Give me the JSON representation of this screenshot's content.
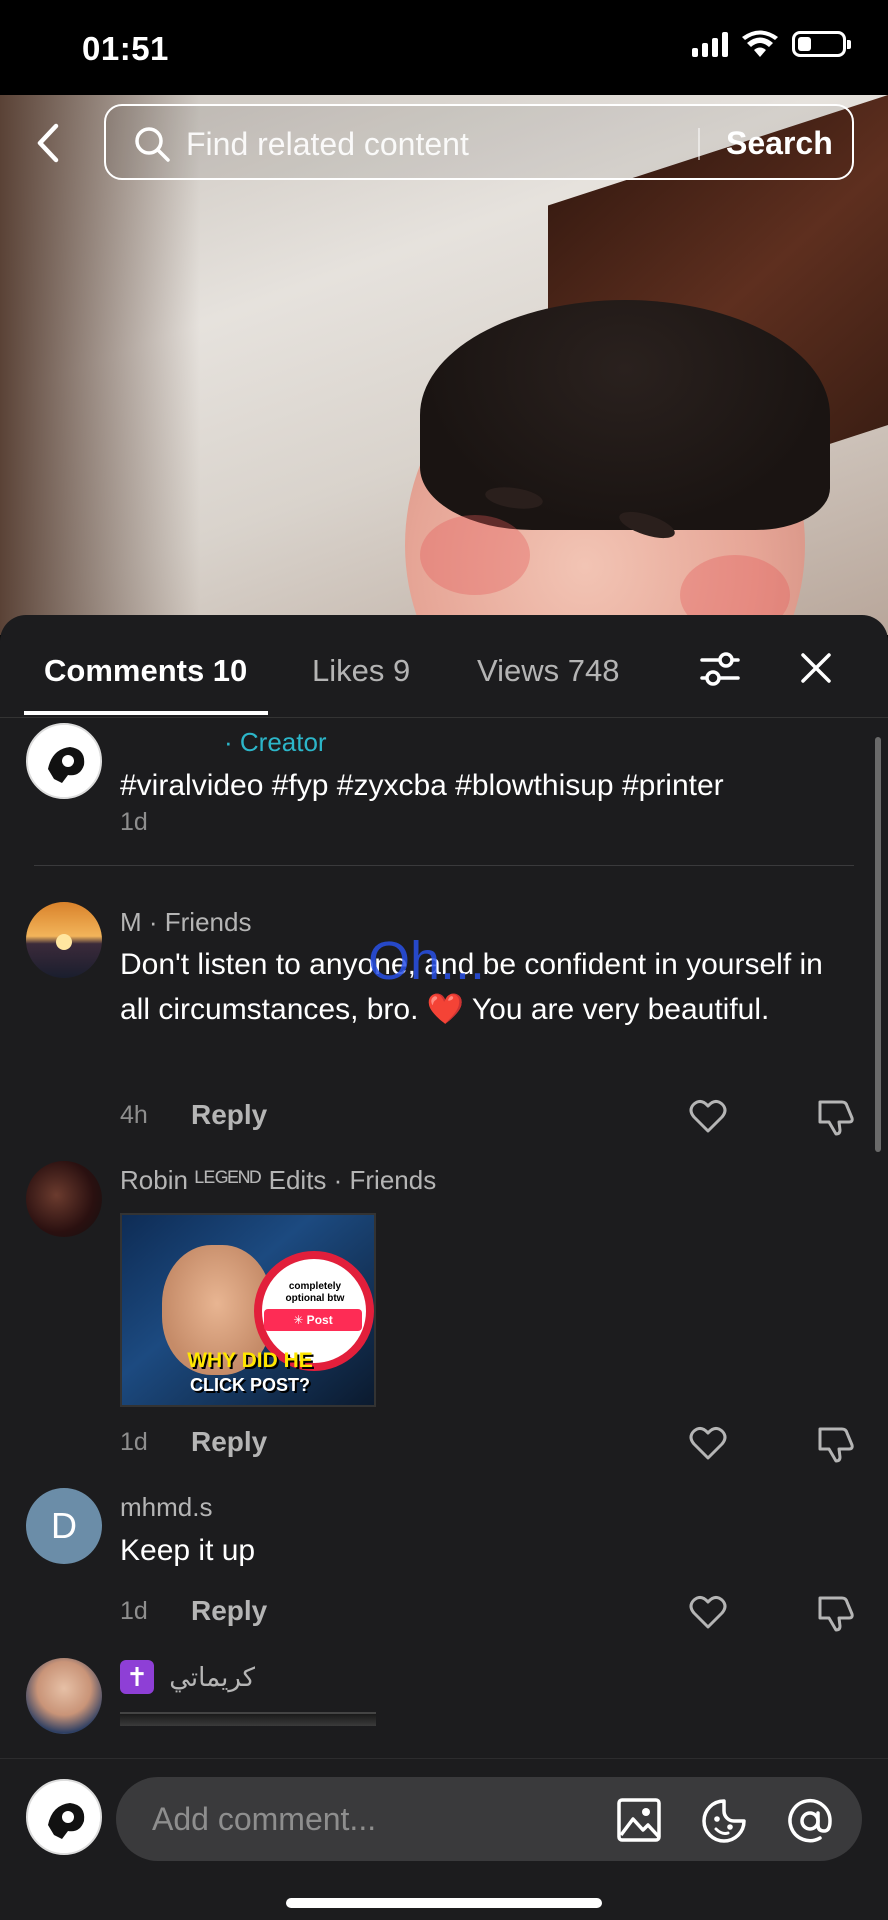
{
  "status_bar": {
    "time": "01:51",
    "battery_level": 0.3
  },
  "search": {
    "placeholder": "Find related content",
    "button_label": "Search"
  },
  "tabs": [
    {
      "label": "Comments 10",
      "active": true
    },
    {
      "label": "Likes 9",
      "active": false
    },
    {
      "label": "Views 748",
      "active": false
    }
  ],
  "comments": [
    {
      "username": "",
      "tag": "· Creator",
      "text": "#viralvideo #fyp #zyxcba #blowthisup #printer",
      "time": "1d"
    },
    {
      "username": "M · Friends",
      "text": "Don't listen to anyone, and be confident in yourself in all circumstances, bro. ❤️ You are very beautiful.",
      "time": "4h",
      "reply": "Reply"
    },
    {
      "username": "Robin ᴸᴱᴳᴱᴺᴰ Edits · Friends",
      "thumbnail": {
        "small_text": "completely optional btw",
        "post_label": "✳ Post",
        "caption_line1": "WHY DID HE",
        "caption_line2": "CLICK POST?"
      },
      "time": "1d",
      "reply": "Reply"
    },
    {
      "avatar_letter": "D",
      "username": "mhmd.s",
      "text": "Keep it up",
      "time": "1d",
      "reply": "Reply"
    },
    {
      "badge": "✝",
      "username": "كريماتي"
    }
  ],
  "overlay_text": "Oh...",
  "comment_input": {
    "placeholder": "Add comment..."
  },
  "colors": {
    "creator_tag": "#2cb6c9",
    "sheet_bg": "#1c1c1e",
    "heart_red": "#e5203f"
  }
}
